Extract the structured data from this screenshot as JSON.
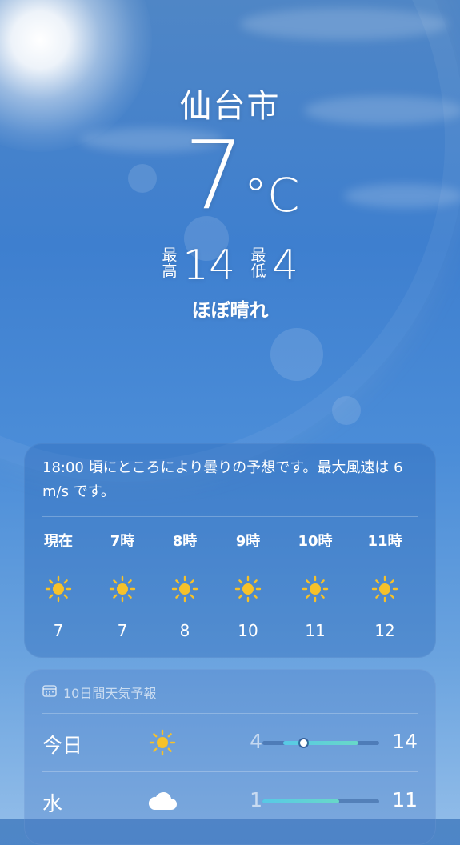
{
  "location": {
    "city": "仙台市"
  },
  "current": {
    "temperature": "7",
    "unit": "°C",
    "high_label": "最高",
    "high": "14",
    "low_label": "最低",
    "low": "4",
    "condition": "ほぼ晴れ"
  },
  "hourly": {
    "summary": "18:00 頃にところにより曇りの予想です。最大風速は 6 m/s です。",
    "items": [
      {
        "time": "現在",
        "icon": "sun-icon",
        "temp": "7"
      },
      {
        "time": "7時",
        "icon": "sun-icon",
        "temp": "7"
      },
      {
        "time": "8時",
        "icon": "sun-icon",
        "temp": "8"
      },
      {
        "time": "9時",
        "icon": "sun-icon",
        "temp": "10"
      },
      {
        "time": "10時",
        "icon": "sun-icon",
        "temp": "11"
      },
      {
        "time": "11時",
        "icon": "sun-icon",
        "temp": "12"
      }
    ]
  },
  "daily": {
    "header": "10日間天気予報",
    "header_icon": "calendar-icon",
    "days": [
      {
        "day": "今日",
        "icon": "sun-icon",
        "low": "4",
        "high": "14",
        "range_start": 0.18,
        "range_end": 0.82,
        "current_marker": 0.35
      },
      {
        "day": "水",
        "icon": "cloud-icon",
        "low": "1",
        "high": "11",
        "range_start": 0.0,
        "range_end": 0.66
      }
    ]
  },
  "colors": {
    "sun": "#f6c12a",
    "range_bar": "#5fd0d6"
  }
}
